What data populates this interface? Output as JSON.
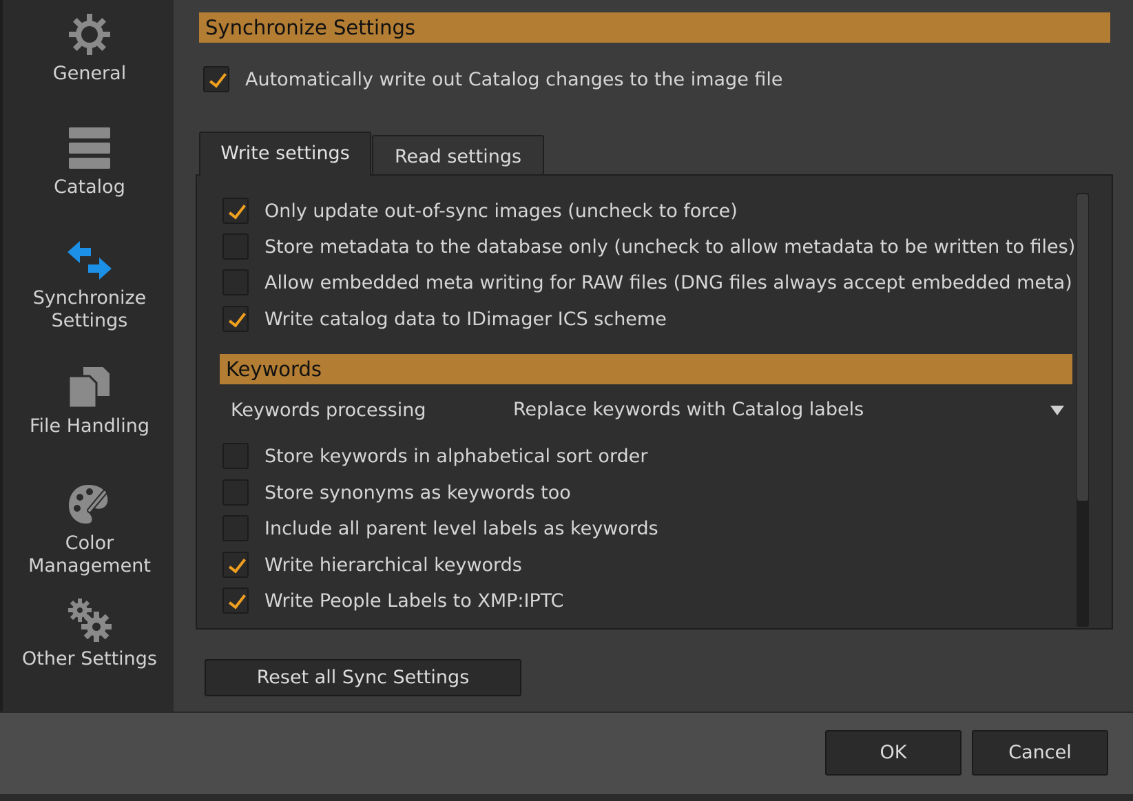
{
  "sidebar": {
    "items": [
      {
        "label": "General",
        "icon": "gear-icon"
      },
      {
        "label": "Catalog",
        "icon": "catalog-stack-icon"
      },
      {
        "label": "Synchronize\nSettings",
        "icon": "sync-arrows-icon"
      },
      {
        "label": "File Handling",
        "icon": "documents-icon"
      },
      {
        "label": "Color\nManagement",
        "icon": "palette-icon"
      },
      {
        "label": "Other Settings",
        "icon": "gears-icon"
      }
    ],
    "active_index": 2,
    "active_icon_color": "#1c8fe6"
  },
  "main": {
    "section_title": "Synchronize Settings",
    "auto_write": {
      "label": "Automatically write out Catalog changes to the image file",
      "checked": true
    },
    "tabs": [
      {
        "label": "Write settings",
        "active": true
      },
      {
        "label": "Read settings",
        "active": false
      }
    ],
    "write_settings": [
      {
        "label": "Only update out-of-sync images (uncheck to force)",
        "checked": true
      },
      {
        "label": "Store metadata to the database only (uncheck to allow metadata to be written to files)",
        "checked": false
      },
      {
        "label": "Allow embedded meta writing for RAW files (DNG files always accept embedded meta)",
        "checked": false
      },
      {
        "label": "Write catalog data to IDimager ICS scheme",
        "checked": true
      }
    ],
    "keywords": {
      "title": "Keywords",
      "processing_label": "Keywords processing",
      "processing_value": "Replace keywords with Catalog labels",
      "options": [
        {
          "label": "Store keywords in alphabetical sort order",
          "checked": false
        },
        {
          "label": "Store synonyms as keywords too",
          "checked": false
        },
        {
          "label": "Include all parent level labels as keywords",
          "checked": false
        },
        {
          "label": "Write hierarchical keywords",
          "checked": true
        },
        {
          "label": "Write People Labels to XMP:IPTC",
          "checked": true
        }
      ]
    },
    "reset_button": "Reset all Sync Settings"
  },
  "footer": {
    "ok": "OK",
    "cancel": "Cancel"
  },
  "colors": {
    "accent_bar": "#b37d33",
    "check": "#f0a01e",
    "background": "#3c3c3c",
    "sidebar": "#2b2b2b"
  }
}
